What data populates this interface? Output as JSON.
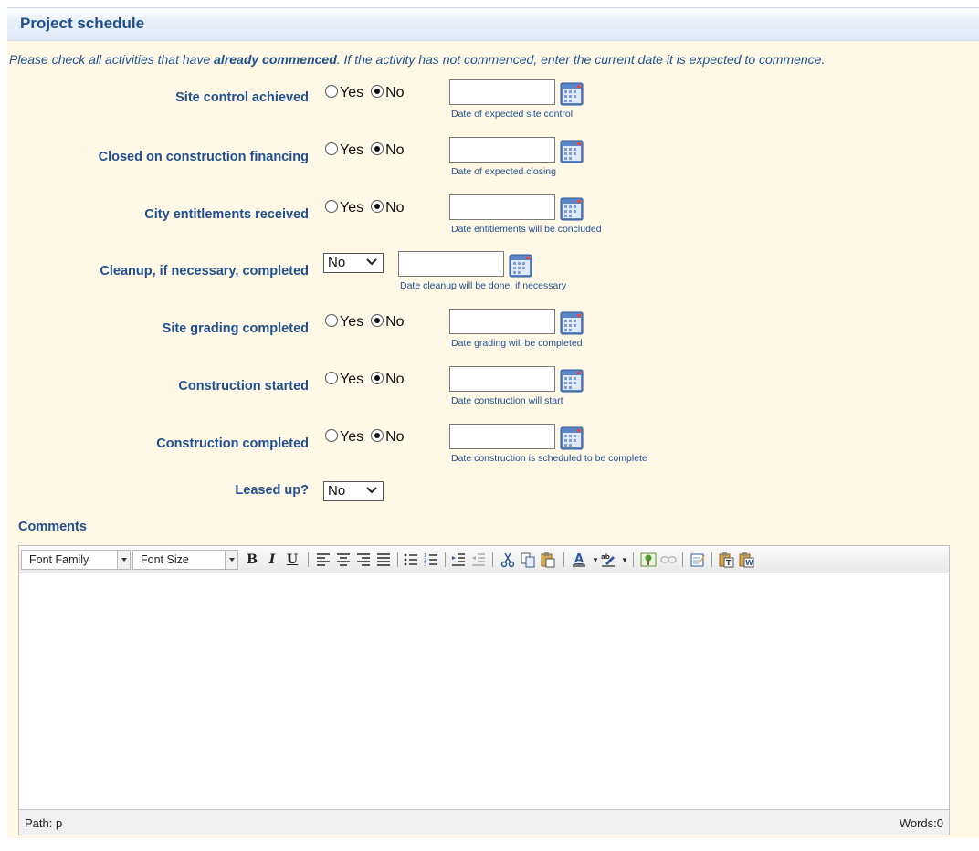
{
  "section": {
    "title": "Project schedule",
    "instructions_prefix": "Please check all activities that have ",
    "instructions_bold": "already commenced",
    "instructions_suffix": ". If the activity has not commenced, enter the current date it is expected to commence."
  },
  "radio_labels": {
    "yes": "Yes",
    "no": "No"
  },
  "rows": [
    {
      "label": "Site control achieved",
      "type": "radio",
      "selected": "No",
      "date_value": "",
      "hint": "Date of expected site control"
    },
    {
      "label": "Closed on construction financing",
      "type": "radio",
      "selected": "No",
      "date_value": "",
      "hint": "Date of expected closing"
    },
    {
      "label": "City entitlements received",
      "type": "radio",
      "selected": "No",
      "date_value": "",
      "hint": "Date entitlements will be concluded"
    },
    {
      "label": "Cleanup, if necessary, completed",
      "type": "select",
      "selected": "No",
      "date_value": "",
      "hint": "Date cleanup will be done, if necessary"
    },
    {
      "label": "Site grading completed",
      "type": "radio",
      "selected": "No",
      "date_value": "",
      "hint": "Date grading will be completed"
    },
    {
      "label": "Construction started",
      "type": "radio",
      "selected": "No",
      "date_value": "",
      "hint": "Date construction will start"
    },
    {
      "label": "Construction completed",
      "type": "radio",
      "selected": "No",
      "date_value": "",
      "hint": "Date construction is scheduled to be complete"
    },
    {
      "label": "Leased up?",
      "type": "select",
      "selected": "No"
    }
  ],
  "comments": {
    "label": "Comments",
    "font_family_label": "Font Family",
    "font_size_label": "Font Size",
    "toolbar_icons": [
      "bold-icon",
      "italic-icon",
      "underline-icon",
      "align-left-icon",
      "align-center-icon",
      "align-right-icon",
      "align-justify-icon",
      "bullet-list-icon",
      "numbered-list-icon",
      "indent-icon",
      "outdent-icon",
      "cut-icon",
      "copy-icon",
      "paste-icon",
      "font-color-icon",
      "highlight-color-icon",
      "image-icon",
      "link-icon",
      "edit-html-icon",
      "paste-text-icon",
      "paste-word-icon"
    ],
    "status_path": "Path: p",
    "status_words": "Words:0"
  },
  "colors": {
    "label_blue": "#1f4f8f",
    "panel_bg": "#fff8e6"
  }
}
